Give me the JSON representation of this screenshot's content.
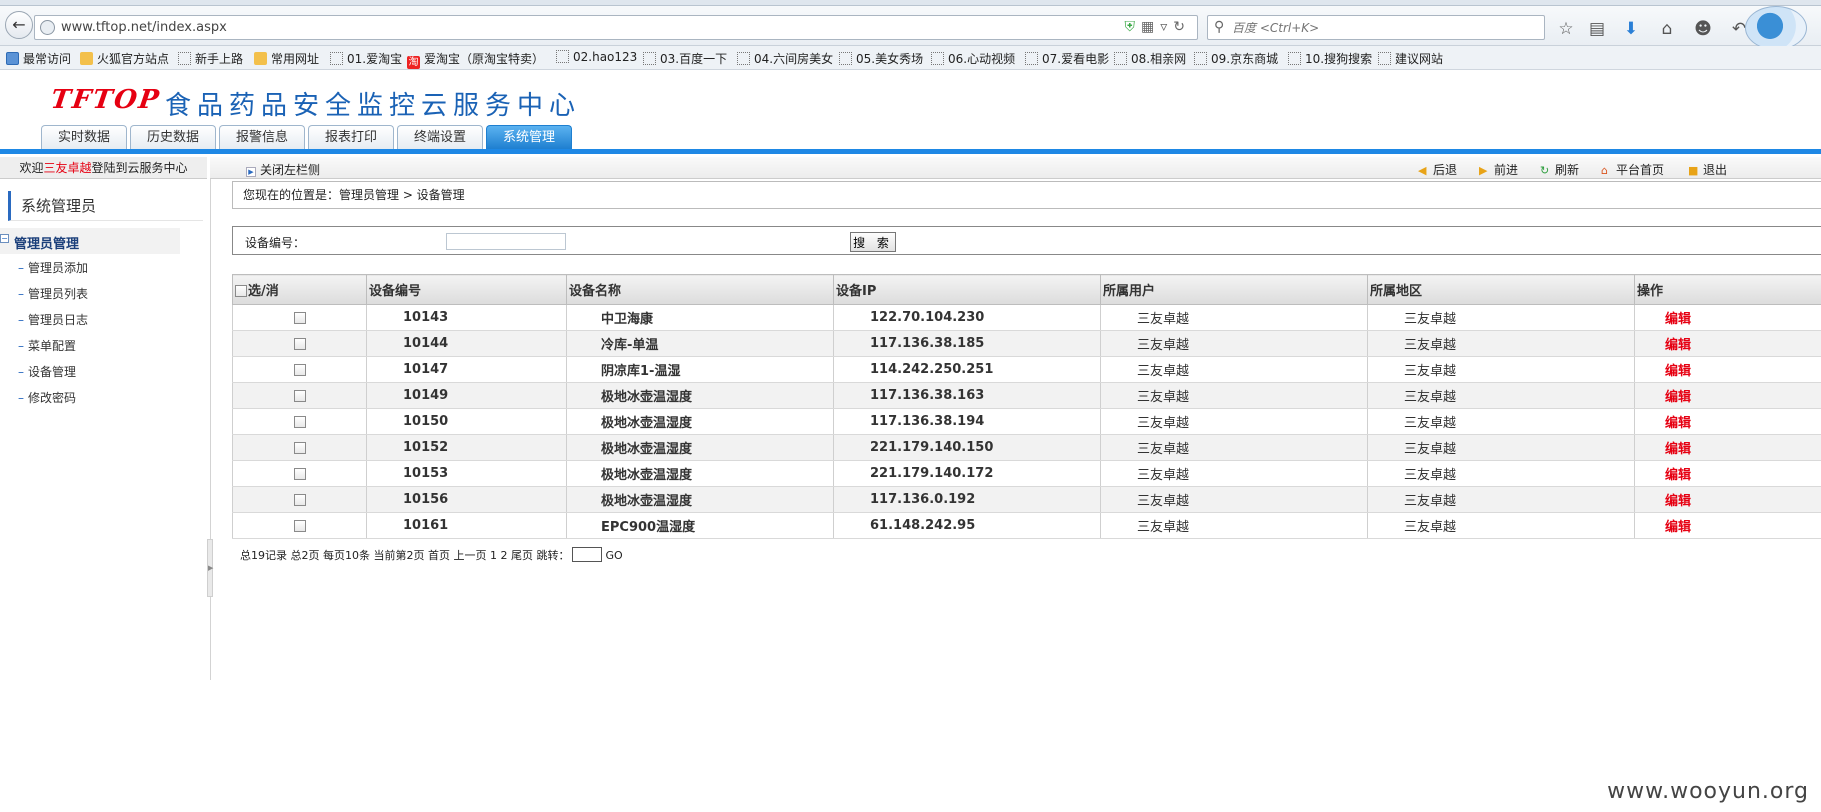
{
  "browser": {
    "url": "www.tftop.net/index.aspx",
    "search_placeholder": "百度 <Ctrl+K>",
    "bookmarks": [
      "最常访问",
      "火狐官方站点",
      "新手上路",
      "常用网址",
      "01.爱淘宝",
      "爱淘宝（原淘宝特卖）",
      "02.hao123",
      "03.百度一下",
      "04.六间房美女",
      "05.美女秀场",
      "06.心动视频",
      "07.爱看电影",
      "08.相亲网",
      "09.京东商城",
      "10.搜狗搜索",
      "建议网站"
    ],
    "taobao_icon_text": "淘"
  },
  "header": {
    "logo": "TFTOP",
    "title": "食品药品安全监控云服务中心",
    "tabs": [
      "实时数据",
      "历史数据",
      "报警信息",
      "报表打印",
      "终端设置",
      "系统管理"
    ],
    "active_tab": "系统管理"
  },
  "welcome": {
    "prefix": "欢迎",
    "user": "三友卓越",
    "suffix": "登陆到云服务中心"
  },
  "toolbar": {
    "close_left": "关闭左栏侧",
    "back": "后退",
    "forward": "前进",
    "refresh": "刷新",
    "home": "平台首页",
    "logout": "退出"
  },
  "sidebar": {
    "header": "系统管理员",
    "group": "管理员管理",
    "items": [
      "管理员添加",
      "管理员列表",
      "管理员日志",
      "菜单配置",
      "设备管理",
      "修改密码"
    ]
  },
  "breadcrumb": "您现在的位置是：管理员管理 > 设备管理",
  "search": {
    "label": "设备编号：",
    "value": "",
    "button": "搜 索"
  },
  "table": {
    "headers": [
      "选/消",
      "设备编号",
      "设备名称",
      "设备IP",
      "所属用户",
      "所属地区",
      "操作"
    ],
    "edit_label": "编辑",
    "rows": [
      {
        "id": "10143",
        "name": "中卫海康",
        "ip": "122.70.104.230",
        "user": "三友卓越",
        "area": "三友卓越"
      },
      {
        "id": "10144",
        "name": "冷库-单温",
        "ip": "117.136.38.185",
        "user": "三友卓越",
        "area": "三友卓越"
      },
      {
        "id": "10147",
        "name": "阴凉库1-温湿",
        "ip": "114.242.250.251",
        "user": "三友卓越",
        "area": "三友卓越"
      },
      {
        "id": "10149",
        "name": "极地冰壶温湿度",
        "ip": "117.136.38.163",
        "user": "三友卓越",
        "area": "三友卓越"
      },
      {
        "id": "10150",
        "name": "极地冰壶温湿度",
        "ip": "117.136.38.194",
        "user": "三友卓越",
        "area": "三友卓越"
      },
      {
        "id": "10152",
        "name": "极地冰壶温湿度",
        "ip": "221.179.140.150",
        "user": "三友卓越",
        "area": "三友卓越"
      },
      {
        "id": "10153",
        "name": "极地冰壶温湿度",
        "ip": "221.179.140.172",
        "user": "三友卓越",
        "area": "三友卓越"
      },
      {
        "id": "10156",
        "name": "极地冰壶温湿度",
        "ip": "117.136.0.192",
        "user": "三友卓越",
        "area": "三友卓越"
      },
      {
        "id": "10161",
        "name": "EPC900温湿度",
        "ip": "61.148.242.95",
        "user": "三友卓越",
        "area": "三友卓越"
      }
    ]
  },
  "pager": {
    "text": "总19记录 总2页 每页10条 当前第2页 首页 上一页 1 2 尾页 跳转：",
    "go": "GO"
  },
  "watermark": "www.wooyun.org",
  "colors": {
    "accent": "#1e88e5",
    "brand_red": "#e60012",
    "title_blue": "#1a62b5"
  }
}
